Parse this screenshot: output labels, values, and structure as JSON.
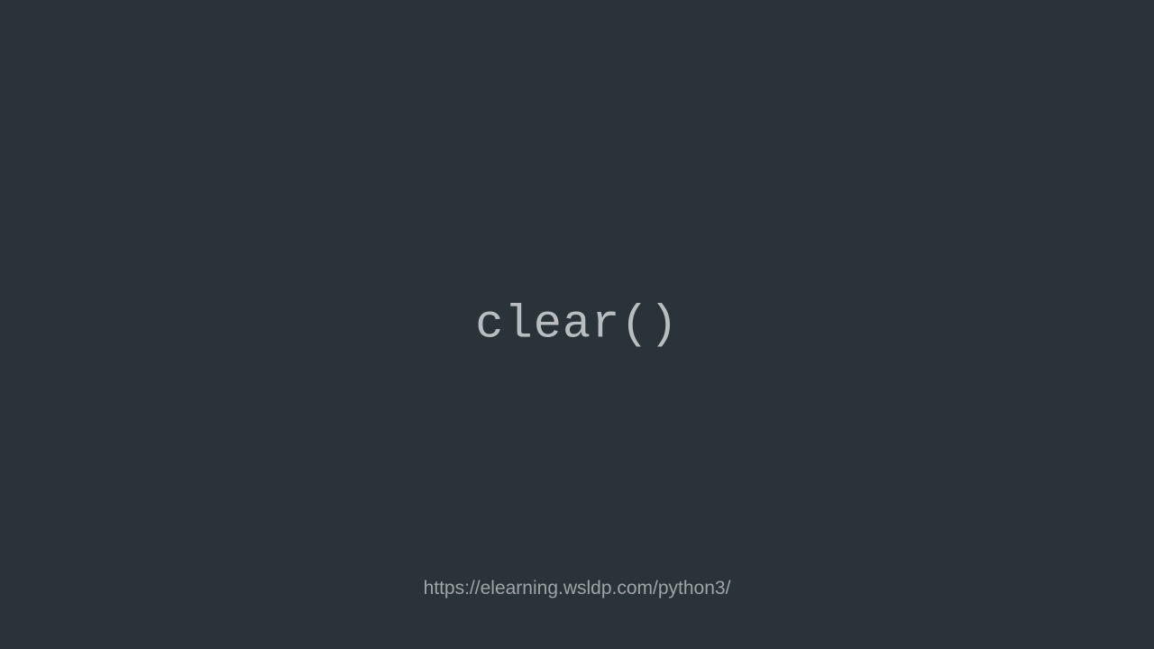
{
  "main": {
    "title": "clear()"
  },
  "footer": {
    "url": "https://elearning.wsldp.com/python3/"
  }
}
